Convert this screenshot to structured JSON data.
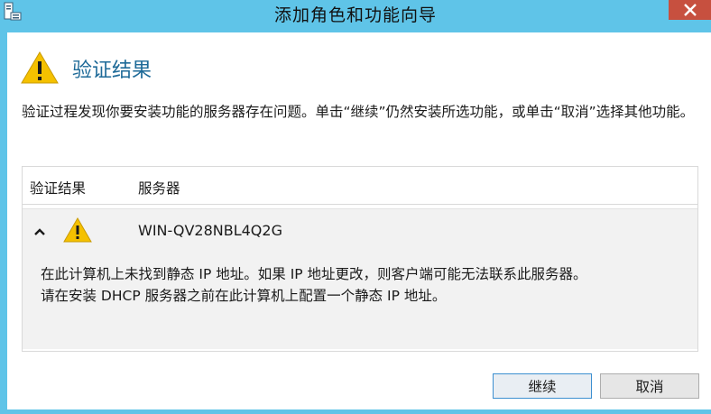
{
  "window": {
    "title": "添加角色和功能向导"
  },
  "heading": "验证结果",
  "description": "验证过程发现你要安装功能的服务器存在问题。单击“继续”仍然安装所选功能，或单击“取消”选择其他功能。",
  "table": {
    "headers": [
      "验证结果",
      "服务器"
    ],
    "rows": [
      {
        "server": "WIN-QV28NBL4Q2G",
        "message_line1": "在此计算机上未找到静态 IP 地址。如果 IP 地址更改，则客户端可能无法联系此服务器。",
        "message_line2": "请在安装 DHCP 服务器之前在此计算机上配置一个静态 IP 地址。"
      }
    ]
  },
  "buttons": {
    "continue": "继续",
    "cancel": "取消"
  },
  "icons": {
    "title": "server-manager-icon",
    "heading": "warning-icon",
    "row": "warning-icon",
    "expand": "chevron-up-icon",
    "close": "close-icon"
  },
  "colors": {
    "titlebar": "#5fc4e8",
    "close": "#c7503f",
    "heading": "#1e6a98",
    "warning": "#f5c100"
  }
}
